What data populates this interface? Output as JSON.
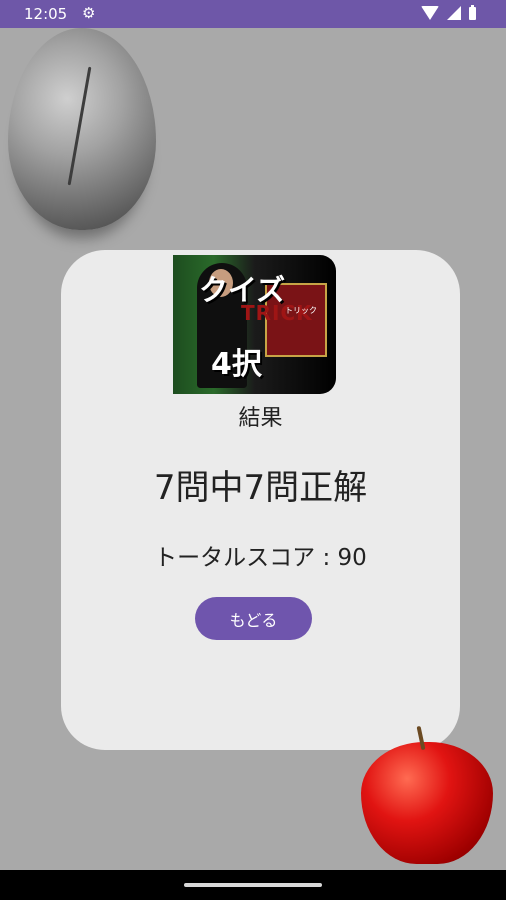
{
  "status_bar": {
    "time": "12:05",
    "gear_icon": "⚙"
  },
  "logo": {
    "line1": "クイズ",
    "line2": "TRICK",
    "line3": "トリック",
    "line4": "4択"
  },
  "result": {
    "title": "結果",
    "score_line": "7問中7問正解",
    "total_score": "トータルスコア : 90"
  },
  "buttons": {
    "back": "もどる"
  },
  "colors": {
    "accent": "#6f55ad",
    "status_bar": "#6e57a8",
    "background": "#a9a9a9",
    "card": "#ebebeb"
  }
}
